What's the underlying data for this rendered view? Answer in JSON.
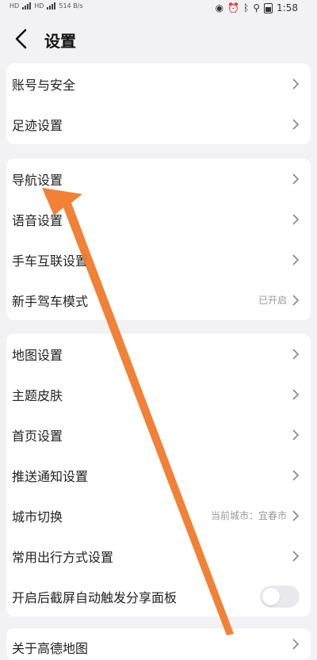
{
  "status_bar": {
    "left_text": "514 B/s",
    "time": "1:58"
  },
  "header": {
    "title": "设置"
  },
  "groups": [
    {
      "items": [
        {
          "label": "账号与安全"
        },
        {
          "label": "足迹设置"
        }
      ]
    },
    {
      "items": [
        {
          "label": "导航设置"
        },
        {
          "label": "语音设置"
        },
        {
          "label": "手车互联设置"
        },
        {
          "label": "新手驾车模式",
          "value": "已开启"
        }
      ]
    },
    {
      "items": [
        {
          "label": "地图设置"
        },
        {
          "label": "主题皮肤"
        },
        {
          "label": "首页设置"
        },
        {
          "label": "推送通知设置"
        },
        {
          "label": "城市切换",
          "value": "当前城市：宜春市"
        },
        {
          "label": "常用出行方式设置"
        },
        {
          "label": "开启后截屏自动触发分享面板",
          "toggle": "off"
        }
      ]
    },
    {
      "items": [
        {
          "label": "关于高德地图"
        }
      ]
    }
  ],
  "colors": {
    "annotation_arrow": "#f07a2c",
    "background": "#f2f2f4"
  }
}
